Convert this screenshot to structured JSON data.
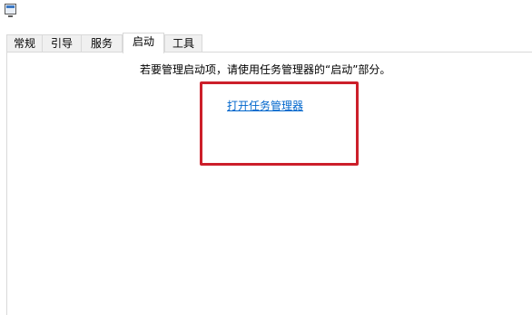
{
  "window": {
    "icon": "msconfig-icon"
  },
  "tabs": [
    {
      "label": "常规",
      "active": false
    },
    {
      "label": "引导",
      "active": false
    },
    {
      "label": "服务",
      "active": false
    },
    {
      "label": "启动",
      "active": true
    },
    {
      "label": "工具",
      "active": false
    }
  ],
  "startup": {
    "message": "若要管理启动项，请使用任务管理器的“启动”部分。",
    "link_label": "打开任务管理器"
  },
  "colors": {
    "highlight_border": "#cc1f2a",
    "link": "#0066cc"
  }
}
